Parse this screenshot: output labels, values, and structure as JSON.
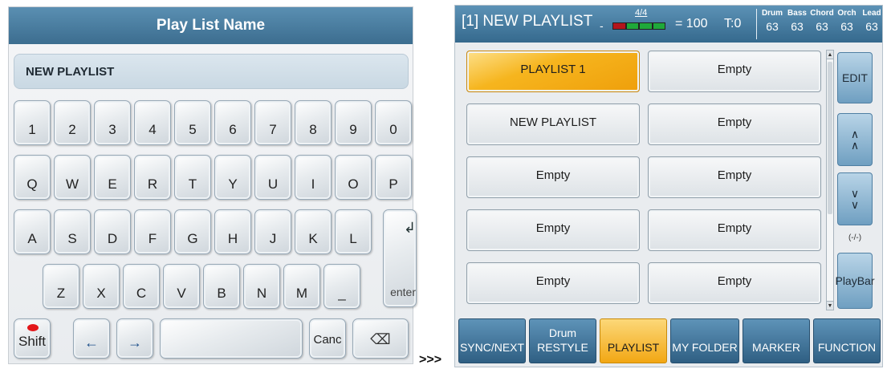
{
  "keyboard": {
    "title": "Play List Name",
    "name_value": "NEW PLAYLIST",
    "row1": [
      "1",
      "2",
      "3",
      "4",
      "5",
      "6",
      "7",
      "8",
      "9",
      "0"
    ],
    "row2": [
      "Q",
      "W",
      "E",
      "R",
      "T",
      "Y",
      "U",
      "I",
      "O",
      "P"
    ],
    "row3": [
      "A",
      "S",
      "D",
      "F",
      "G",
      "H",
      "J",
      "K",
      "L"
    ],
    "row4": [
      "Z",
      "X",
      "C",
      "V",
      "B",
      "N",
      "M",
      "_"
    ],
    "enter_label": "enter",
    "enter_glyph": "↲",
    "shift_label": "Shift",
    "left_glyph": "←",
    "right_glyph": "→",
    "cancel_label": "Canc",
    "backspace_glyph": "⌫"
  },
  "separator": ">>>",
  "playlist": {
    "status": {
      "title": "[1] NEW PLAYLIST",
      "dash": "-",
      "time_signature": "4/4",
      "tempo": "= 100",
      "transpose": "T:0",
      "volumes": [
        {
          "name": "Drum",
          "value": "63"
        },
        {
          "name": "Bass",
          "value": "63"
        },
        {
          "name": "Chord",
          "value": "63"
        },
        {
          "name": "Orch",
          "value": "63"
        },
        {
          "name": "Lead",
          "value": "63"
        }
      ]
    },
    "slots": [
      [
        "PLAYLIST 1",
        "Empty"
      ],
      [
        "NEW PLAYLIST",
        "Empty"
      ],
      [
        "Empty",
        "Empty"
      ],
      [
        "Empty",
        "Empty"
      ],
      [
        "Empty",
        "Empty"
      ]
    ],
    "active_slot": "PLAYLIST 1",
    "side": {
      "edit": "EDIT",
      "up": "∧\n∧",
      "down": "∨\n∨",
      "page": "(-/-)",
      "playbar": "PlayBar"
    },
    "tabs": [
      {
        "line1": "SYNC/NEXT",
        "line2": ""
      },
      {
        "line1": "Drum",
        "line2": "RESTYLE"
      },
      {
        "line1": "PLAYLIST",
        "line2": ""
      },
      {
        "line1": "MY FOLDER",
        "line2": ""
      },
      {
        "line1": "MARKER",
        "line2": ""
      },
      {
        "line1": "FUNCTION",
        "line2": ""
      }
    ],
    "active_tab": "PLAYLIST"
  },
  "colors": {
    "header_blue": "#3c6d8f",
    "active_orange": "#f6b51e",
    "meter_green": "#1fa83a",
    "meter_red": "#b3141b"
  }
}
